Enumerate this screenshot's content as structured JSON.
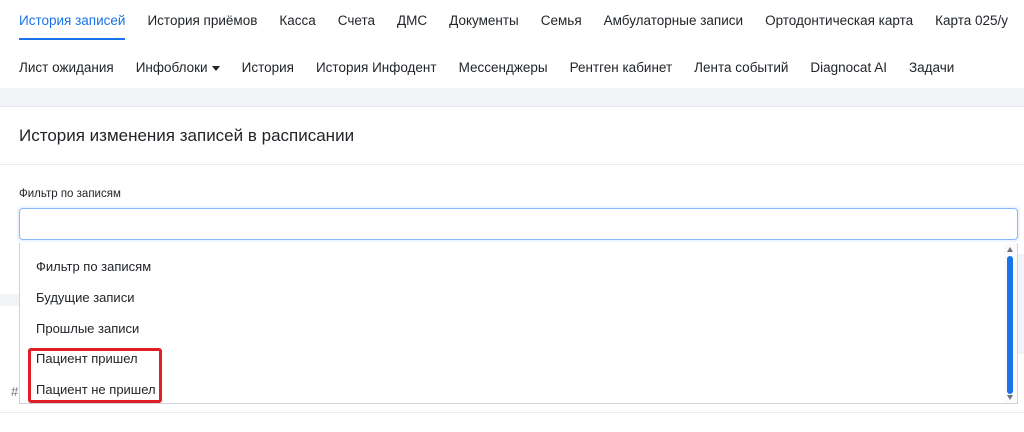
{
  "nav": {
    "row1": [
      {
        "label": "История записей",
        "active": true
      },
      {
        "label": "История приёмов"
      },
      {
        "label": "Касса"
      },
      {
        "label": "Счета"
      },
      {
        "label": "ДМС"
      },
      {
        "label": "Документы"
      },
      {
        "label": "Семья"
      },
      {
        "label": "Амбулаторные записи"
      },
      {
        "label": "Ортодонтическая карта"
      },
      {
        "label": "Карта 025/у"
      }
    ],
    "row2": [
      {
        "label": "Лист ожидания"
      },
      {
        "label": "Инфоблоки",
        "dropdown": true
      },
      {
        "label": "История"
      },
      {
        "label": "История Инфодент"
      },
      {
        "label": "Мессенджеры"
      },
      {
        "label": "Рентген кабинет"
      },
      {
        "label": "Лента событий"
      },
      {
        "label": "Diagnocat AI"
      },
      {
        "label": "Задачи"
      }
    ]
  },
  "card": {
    "title": "История изменения записей в расписании",
    "filter_label": "Фильтр по записям",
    "filter_value": ""
  },
  "table": {
    "first_header": "#"
  },
  "dropdown": {
    "options": [
      "Фильтр по записям",
      "Будущие записи",
      "Прошлые записи",
      "Пациент пришел",
      "Пациент не пришел"
    ]
  },
  "colors": {
    "accent": "#1a73e8",
    "highlight": "#e11d26"
  }
}
